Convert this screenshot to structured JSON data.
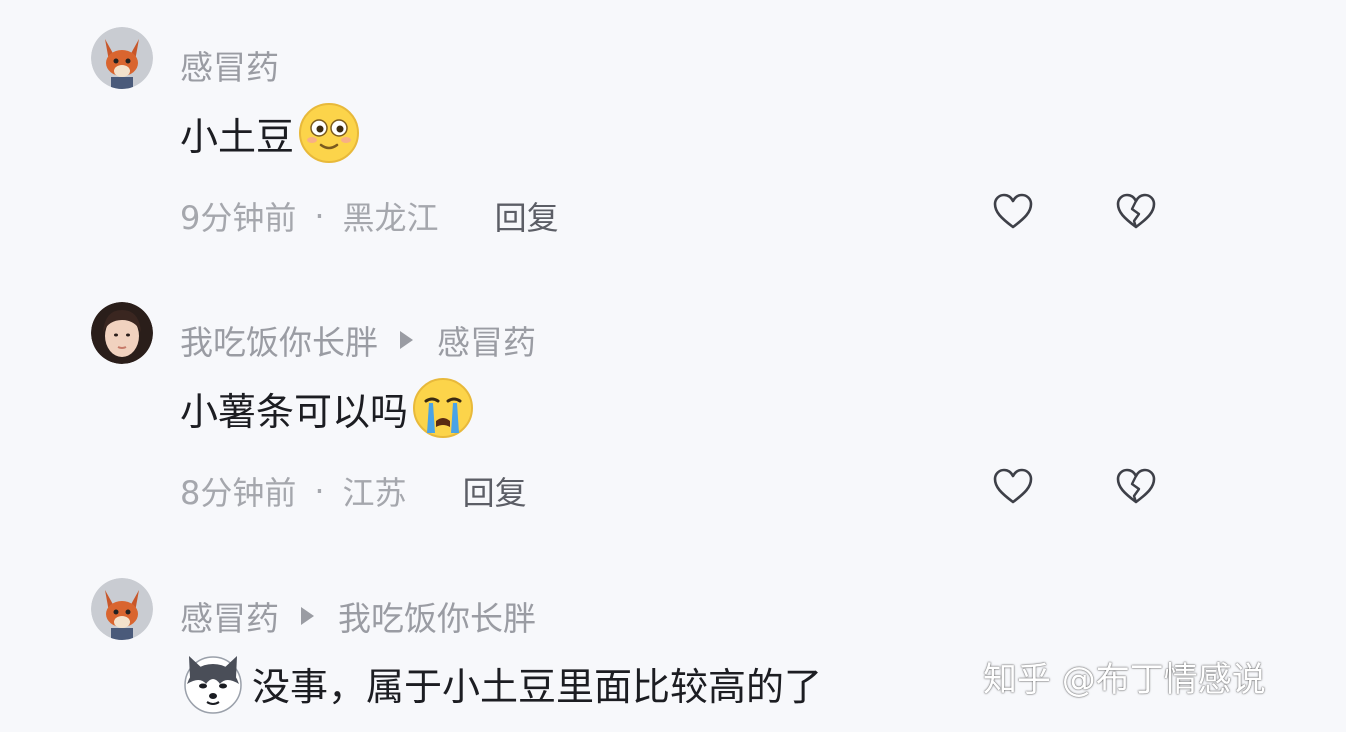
{
  "comments": [
    {
      "author": "感冒药",
      "reply_to": "",
      "text": "小土豆",
      "emoji": "smiling-face-emoji",
      "time": "9分钟前",
      "location": "黑龙江",
      "reply_label": "回复"
    },
    {
      "author": "我吃饭你长胖",
      "reply_to": "感冒药",
      "text": "小薯条可以吗",
      "emoji": "crying-face-emoji",
      "time": "8分钟前",
      "location": "江苏",
      "reply_label": "回复"
    },
    {
      "author": "感冒药",
      "reply_to": "我吃饭你长胖",
      "text": "没事，属于小土豆里面比较高的了",
      "emoji": "husky-dog-emoji"
    }
  ],
  "separator": "·",
  "icons": {
    "like": "heart-outline-icon",
    "dislike": "broken-heart-icon"
  },
  "watermark": "知乎 @布丁情感说",
  "colors": {
    "background": "#f7f8fb",
    "name": "#9a9ca3",
    "text": "#1c1d22",
    "meta": "#a5a7ad"
  }
}
